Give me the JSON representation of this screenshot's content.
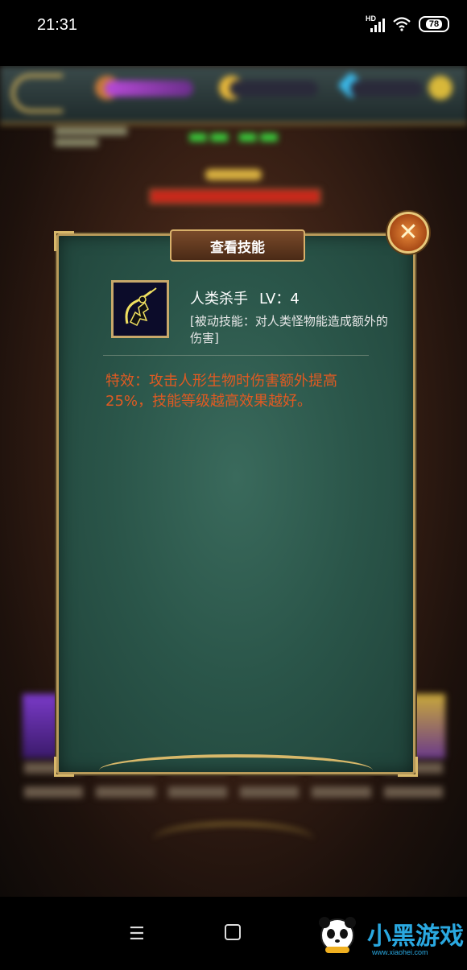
{
  "status_bar": {
    "time": "21:31",
    "network": "HD",
    "battery": "78",
    "icons": [
      "signal-icon",
      "wifi-icon",
      "battery-icon"
    ]
  },
  "dialog": {
    "title": "查看技能",
    "close_icon": "close-icon",
    "skill": {
      "name": "人类杀手",
      "level": "LV：4",
      "description": "[被动技能：对人类怪物能造成额外的伤害]",
      "effect": "特效：攻击人形生物时伤害额外提高25%，技能等级越高效果越好。"
    }
  },
  "nav_bar": {
    "menu_glyph": "☰",
    "watermark_text": "小黑游戏",
    "watermark_url": "www.xiaohei.com"
  }
}
